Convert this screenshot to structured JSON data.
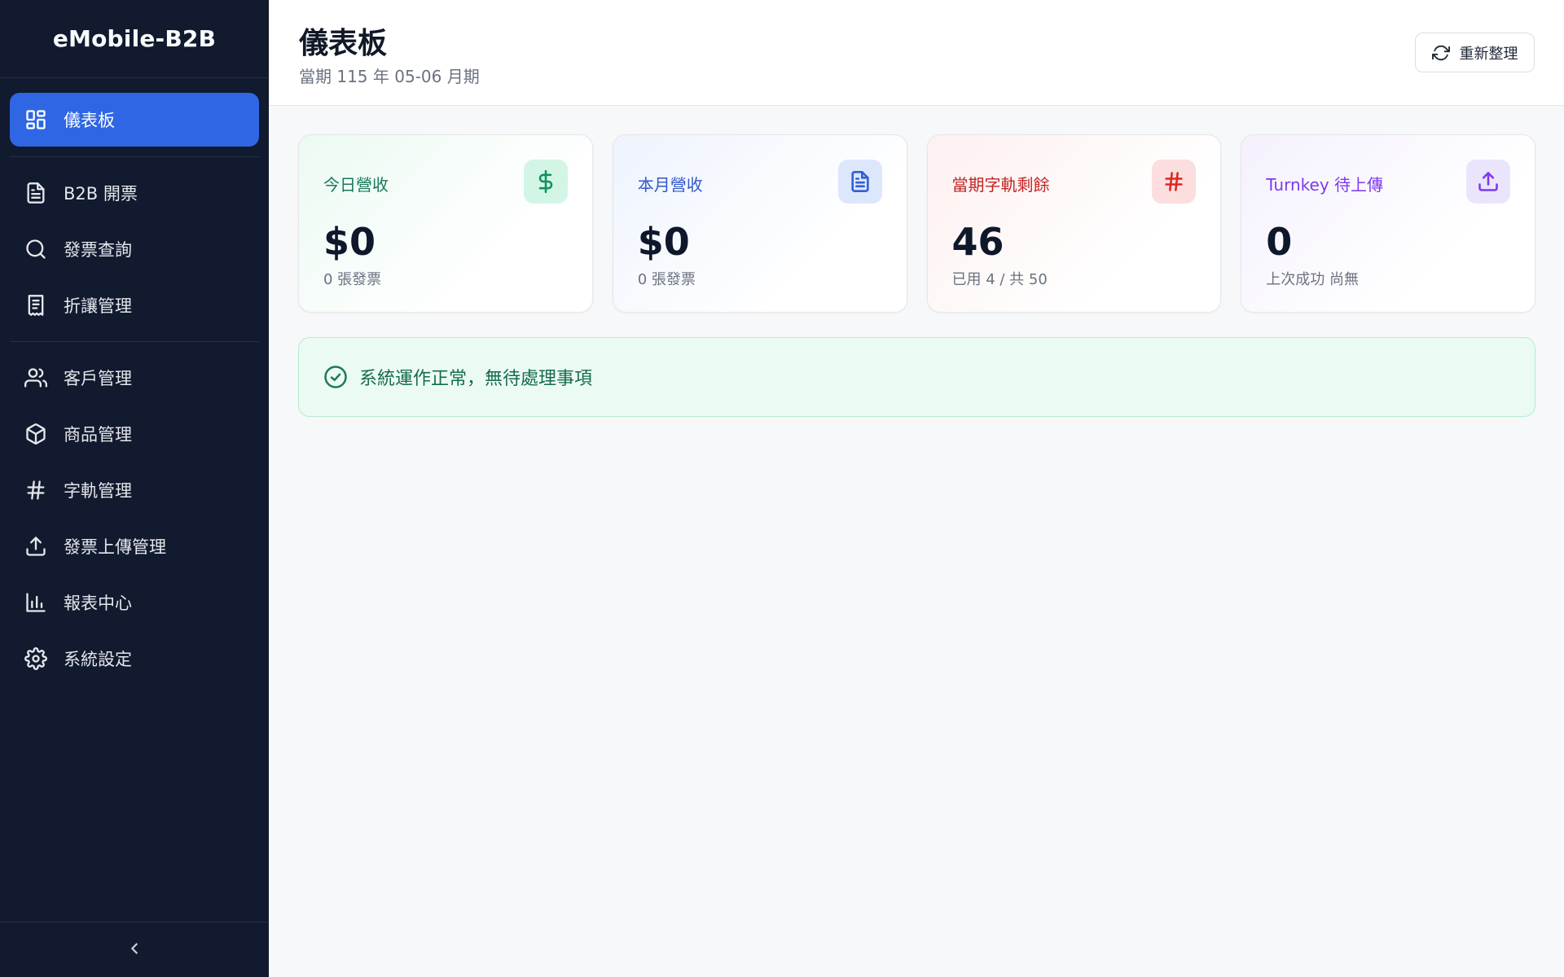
{
  "app": {
    "brand": "eMobile-B2B"
  },
  "sidebar": {
    "items": [
      {
        "label": "儀表板",
        "icon": "dashboard-grid-icon",
        "active": true
      },
      {
        "label": "B2B 開票",
        "icon": "file-text-icon"
      },
      {
        "label": "發票查詢",
        "icon": "search-icon"
      },
      {
        "label": "折讓管理",
        "icon": "receipt-icon"
      },
      {
        "label": "客戶管理",
        "icon": "users-icon"
      },
      {
        "label": "商品管理",
        "icon": "package-icon"
      },
      {
        "label": "字軌管理",
        "icon": "hash-icon"
      },
      {
        "label": "發票上傳管理",
        "icon": "upload-icon"
      },
      {
        "label": "報表中心",
        "icon": "bar-chart-icon"
      },
      {
        "label": "系統設定",
        "icon": "gear-icon"
      }
    ],
    "collapse_icon": "chevron-left-icon"
  },
  "header": {
    "title": "儀表板",
    "subtitle": "當期 115 年 05-06 月期",
    "refresh_label": "重新整理",
    "refresh_icon": "refresh-icon"
  },
  "cards": [
    {
      "label": "今日營收",
      "value": "$0",
      "sub": "0 張發票",
      "icon": "dollar-icon",
      "accent": "#12935f"
    },
    {
      "label": "本月營收",
      "value": "$0",
      "sub": "0 張發票",
      "icon": "document-icon",
      "accent": "#2f5fd6"
    },
    {
      "label": "當期字軌剩餘",
      "value": "46",
      "sub": "已用 4 / 共 50",
      "icon": "hash-icon",
      "accent": "#e02424"
    },
    {
      "label": "Turnkey 待上傳",
      "value": "0",
      "sub": "上次成功 尚無",
      "icon": "upload-icon",
      "accent": "#7c3aed"
    }
  ],
  "status": {
    "message": "系統運作正常，無待處理事項",
    "icon": "check-circle-icon",
    "color": "#166b4e"
  },
  "colors": {
    "sidebar_bg": "#111a2e",
    "active_nav": "#2f66e3",
    "page_bg": "#f7f8fa"
  }
}
